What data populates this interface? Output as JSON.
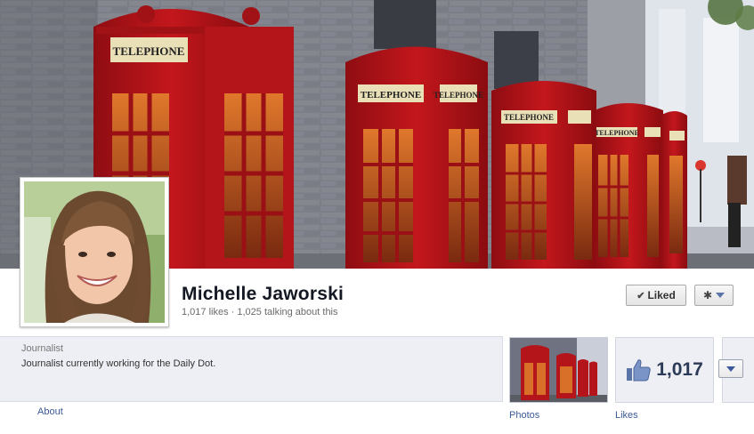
{
  "cover": {
    "phone_box_sign": "TELEPHONE",
    "colors": {
      "phone_box_red": "#b8141a",
      "brick": "#7f8089",
      "sign_cream": "#e9e0b8"
    }
  },
  "header": {
    "page_name": "Michelle Jaworski",
    "stats": "1,017 likes · 1,025 talking about this",
    "liked_label": "Liked",
    "liked_icon": "check-icon",
    "settings_icon": "gear-icon"
  },
  "about": {
    "label": "Journalist",
    "description": "Journalist currently working for the Daily Dot.",
    "link": "About"
  },
  "apps": {
    "photos_label": "Photos",
    "likes_count": "1,017",
    "likes_icon": "thumbs-up-icon",
    "likes_label": "Likes",
    "more_icon": "chevron-down-icon"
  },
  "colors": {
    "link": "#3b5998",
    "panel_bg": "#edeff4",
    "name": "#141823"
  }
}
